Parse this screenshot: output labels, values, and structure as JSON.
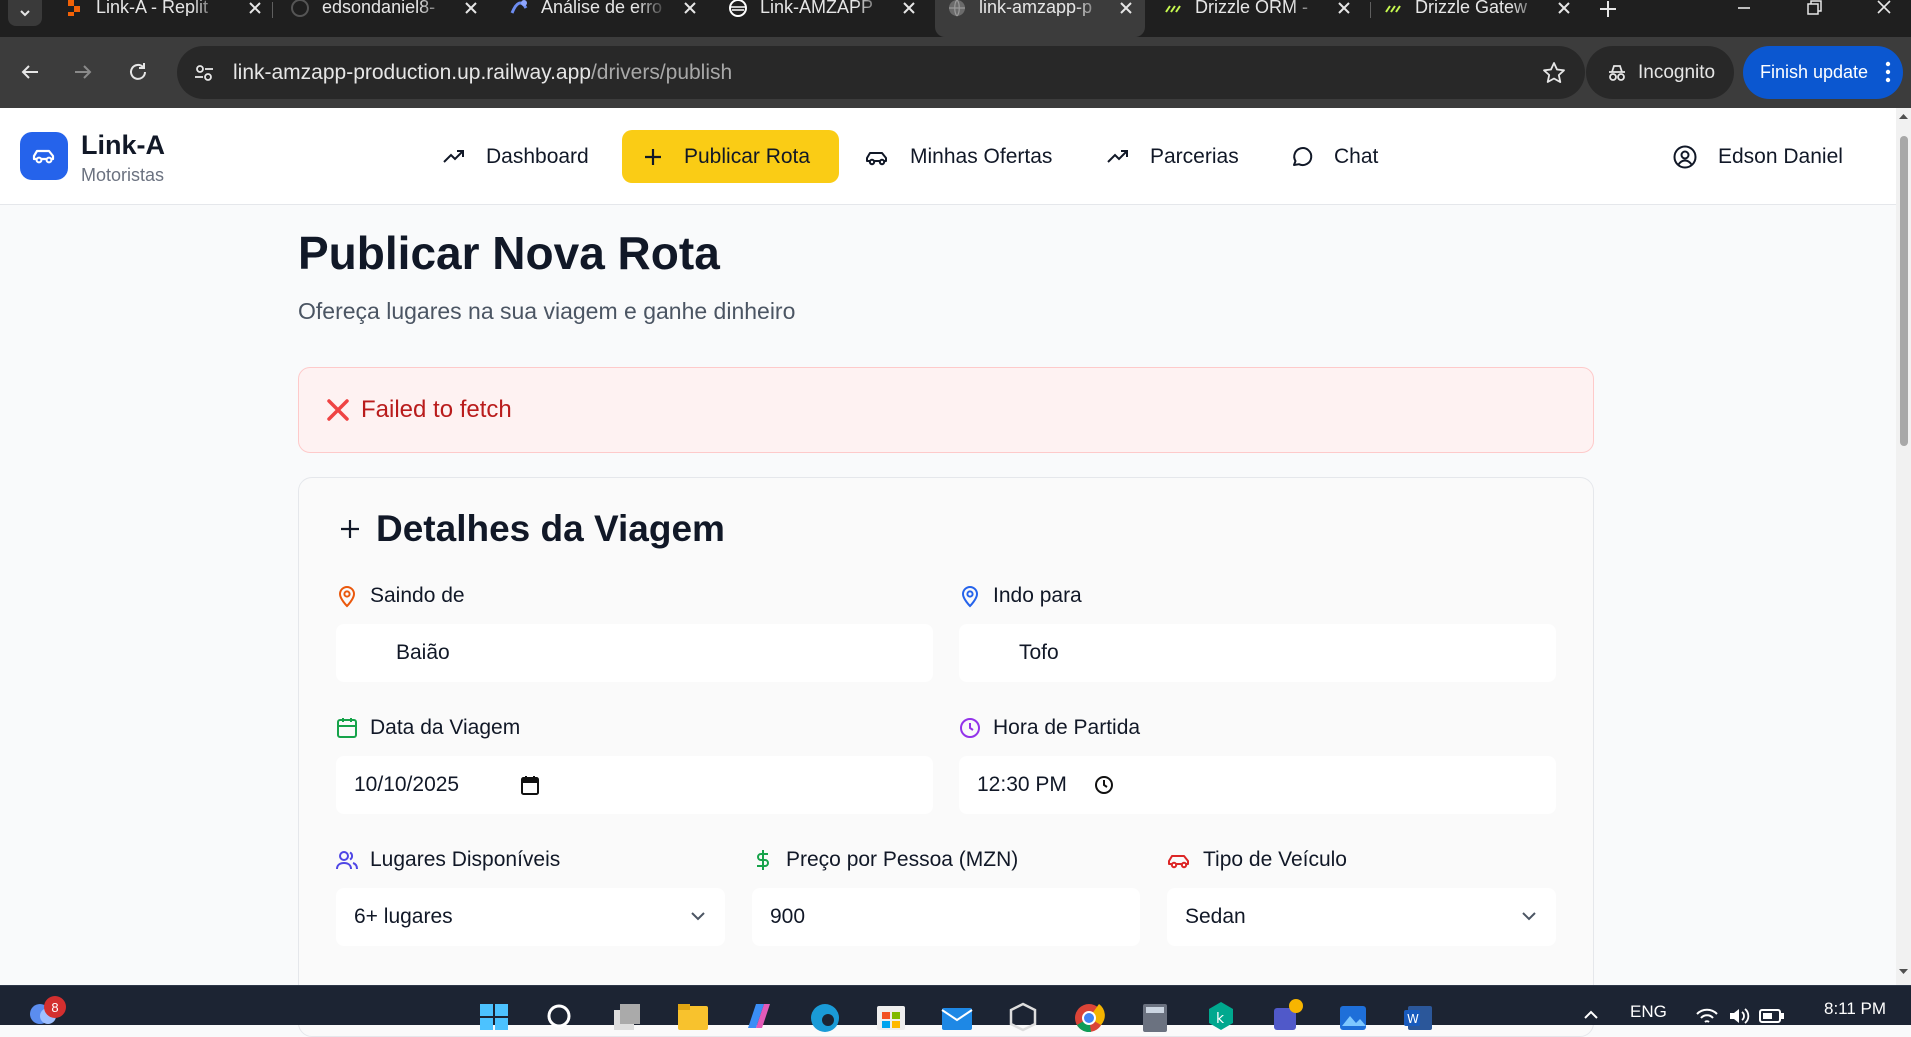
{
  "browser": {
    "tabs": [
      {
        "title": "Link-A - Replit",
        "active": false,
        "favicon": "replit-icon"
      },
      {
        "title": "edsondaniel8-",
        "active": false,
        "favicon": "github-icon"
      },
      {
        "title": "Análise de erro",
        "active": false,
        "favicon": "app-icon"
      },
      {
        "title": "Link-AMZAPP",
        "active": false,
        "favicon": "railway-icon"
      },
      {
        "title": "link-amzapp-p",
        "active": true,
        "favicon": "globe-icon"
      },
      {
        "title": "Drizzle ORM -",
        "active": false,
        "favicon": "drizzle-icon"
      },
      {
        "title": "Drizzle Gatew",
        "active": false,
        "favicon": "drizzle-icon"
      }
    ],
    "url_host": "link-amzapp-production.up.railway.app",
    "url_path": "/drivers/publish",
    "incognito_label": "Incognito",
    "finish_update_label": "Finish update"
  },
  "app": {
    "brand": {
      "name": "Link-A",
      "subtitle": "Motoristas"
    },
    "nav": [
      {
        "label": "Dashboard",
        "icon": "trending-up-icon",
        "active": false
      },
      {
        "label": "Publicar Rota",
        "icon": "plus-icon",
        "active": true
      },
      {
        "label": "Minhas Ofertas",
        "icon": "car-icon",
        "active": false
      },
      {
        "label": "Parcerias",
        "icon": "trending-up-icon",
        "active": false
      },
      {
        "label": "Chat",
        "icon": "chat-icon",
        "active": false
      }
    ],
    "user_name": "Edson Daniel"
  },
  "page": {
    "title": "Publicar Nova Rota",
    "subtitle": "Ofereça lugares na sua viagem e ganhe dinheiro",
    "error": "Failed to fetch"
  },
  "form": {
    "section_title": "Detalhes da Viagem",
    "from": {
      "label": "Saindo de",
      "value": "Baião"
    },
    "to": {
      "label": "Indo para",
      "value": "Tofo"
    },
    "date": {
      "label": "Data da Viagem",
      "value": "10/10/2025"
    },
    "time": {
      "label": "Hora de Partida",
      "value": "12:30 PM"
    },
    "seats": {
      "label": "Lugares Disponíveis",
      "value": "6+ lugares"
    },
    "price": {
      "label": "Preço por Pessoa (MZN)",
      "value": "900"
    },
    "vehicle": {
      "label": "Tipo de Veículo",
      "value": "Sedan"
    }
  },
  "taskbar": {
    "notification_count": "8",
    "language": "ENG",
    "time": "8:11 PM"
  },
  "colors": {
    "brand_blue": "#2563eb",
    "active_nav": "#facc15",
    "error_text": "#b91c1c",
    "error_bg": "#fef2f2",
    "from_icon": "#ea580c",
    "to_icon": "#2563eb",
    "date_icon": "#16a34a",
    "time_icon": "#9333ea",
    "seats_icon": "#4f46e5",
    "price_icon": "#16a34a",
    "vehicle_icon": "#dc2626"
  }
}
